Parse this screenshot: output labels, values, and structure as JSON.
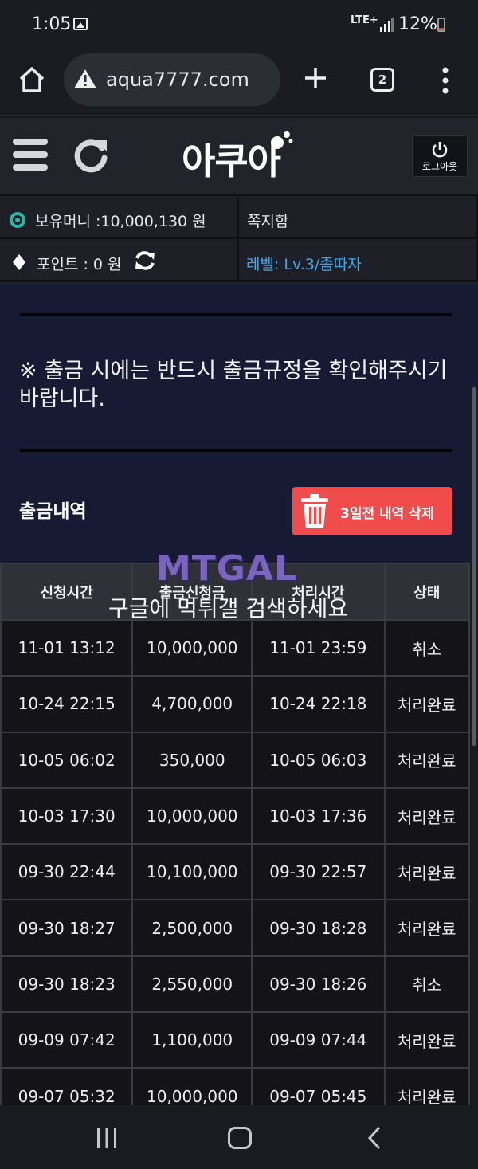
{
  "status_bar": {
    "time": "1:05",
    "network": "LTE+",
    "battery": "12%"
  },
  "browser": {
    "url": "aqua7777.com",
    "tab_count": "2"
  },
  "site": {
    "logo": "아쿠아",
    "logout_label": "로그아웃"
  },
  "info": {
    "money": "보유머니 :10,000,130 원",
    "messages": "쪽지함",
    "points": "포인트 :   0 원",
    "level": "레벨: Lv.3/좀따자"
  },
  "notice": "※ 출금 시에는 반드시 출금규정을 확인해주시기 바랍니다.",
  "section": {
    "title": "출금내역",
    "delete_label": "3일전 내역 삭제"
  },
  "table": {
    "headers": [
      "신청시간",
      "출금신청금",
      "처리시간",
      "상태"
    ],
    "rows": [
      [
        "11-01 13:12",
        "10,000,000",
        "11-01 23:59",
        "취소"
      ],
      [
        "10-24 22:15",
        "4,700,000",
        "10-24 22:18",
        "처리완료"
      ],
      [
        "10-05 06:02",
        "350,000",
        "10-05 06:03",
        "처리완료"
      ],
      [
        "10-03 17:30",
        "10,000,000",
        "10-03 17:36",
        "처리완료"
      ],
      [
        "09-30 22:44",
        "10,100,000",
        "09-30 22:57",
        "처리완료"
      ],
      [
        "09-30 18:27",
        "2,500,000",
        "09-30 18:28",
        "처리완료"
      ],
      [
        "09-30 18:23",
        "2,550,000",
        "09-30 18:26",
        "취소"
      ],
      [
        "09-09 07:42",
        "1,100,000",
        "09-09 07:44",
        "처리완료"
      ],
      [
        "09-07 05:32",
        "10,000,000",
        "09-07 05:45",
        "처리완료"
      ]
    ]
  },
  "watermark": {
    "logo": "MTGAL",
    "text": "구글에 먹튀갤 검색하세요"
  },
  "colors": {
    "accent_red": "#f04c4c",
    "level_blue": "#3ea8ec",
    "content_bg": "#161b33"
  }
}
